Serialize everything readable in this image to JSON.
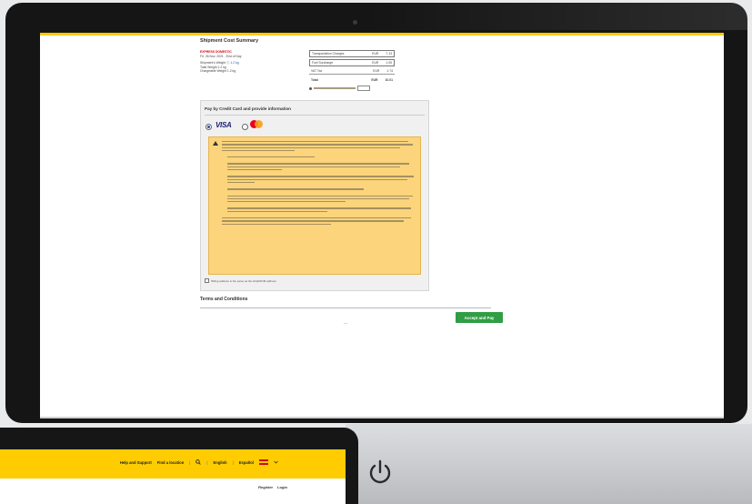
{
  "page": {
    "title": "Shipment Cost Summary"
  },
  "summary": {
    "product": "EXPRESS DOMESTIC",
    "date": "Fri, 26 Nov, 2021 - End of Day",
    "declared_weight": "Shipment's Weight ⓘ",
    "declared_weight_value": "1.2 kg",
    "total_weight": "Total Weight 1.2 kg",
    "chargeable_weight": "Chargeable Weight 1.2 kg"
  },
  "charges": {
    "rows": [
      {
        "label": "Transportation Charges",
        "currency": "EUR",
        "amount": "7.13"
      },
      {
        "label": "Fuel Surcharge",
        "currency": "EUR",
        "amount": "1.05"
      },
      {
        "label": "VAT Tax",
        "currency": "EUR",
        "amount": "1.74"
      }
    ],
    "total_label": "Total",
    "total_currency": "EUR",
    "total_amount": "10.01"
  },
  "payment": {
    "title": "Pay by Credit Card and provide information",
    "visa_label": "VISA"
  },
  "billing_label": "Billing address is the same as the shipFROM address",
  "terms": {
    "title": "Terms and Conditions"
  },
  "actions": {
    "accept_label": "Accept and Pay",
    "dash": "—"
  },
  "laptop_nav": {
    "help": "Help and Support",
    "find_location": "Find a location",
    "sep": "|",
    "english": "English",
    "espanol": "Español",
    "register": "Register",
    "login": "Login"
  },
  "colors": {
    "brand_yellow": "#fecc00",
    "accept_green": "#2f9e44",
    "notice_amber": "#fbd47b"
  }
}
